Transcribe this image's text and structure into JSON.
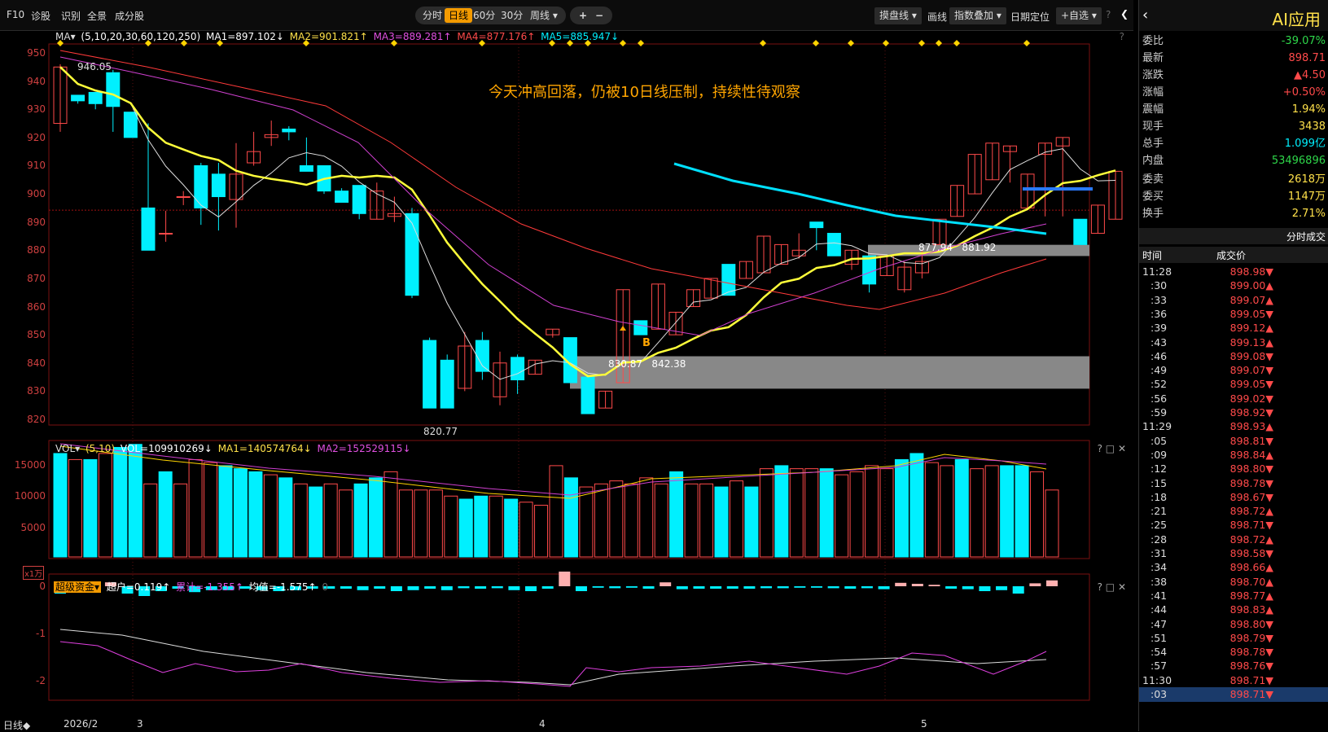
{
  "toolbar": {
    "left": [
      "F10",
      "诊股",
      "识别",
      "全景",
      "成分股"
    ],
    "periods": [
      "分时",
      "日线",
      "60分",
      "30分",
      "周线 ▾"
    ],
    "active_period": "日线",
    "zoom": [
      "+",
      "−"
    ],
    "right": [
      "摸盘线 ▾",
      "画线",
      "指数叠加 ▾",
      "日期定位",
      "+自选 ▾"
    ],
    "help": "?",
    "collapse": "❮"
  },
  "main": {
    "indicator": "MA▾",
    "params": "(5,10,20,30,60,120,250)",
    "ma1": "MA1=897.102↓",
    "ma2": "MA2=901.821↑",
    "ma3": "MA3=889.281↑",
    "ma4": "MA4=877.176↑",
    "ma5": "MA5=885.947↓",
    "help": "?",
    "annotation": "今天冲高回落，仍被10日线压制，持续性待观察",
    "hi_label": "946.05",
    "lo_label": "820.77",
    "zone1_label": "830.87   842.38",
    "zone2_label": "877.94   881.92",
    "b_marker": "B",
    "yticks": [
      "950",
      "940",
      "930",
      "920",
      "910",
      "900",
      "890",
      "880",
      "870",
      "860",
      "850",
      "840",
      "830",
      "820"
    ]
  },
  "vol": {
    "indicator": "VOL▾",
    "params": "(5,10)",
    "vol": "VOL=109910269↓",
    "ma1": "MA1=140574764↓",
    "ma2": "MA2=152529115↓",
    "yticks": [
      "15000",
      "10000",
      "5000"
    ],
    "unit": "x1万",
    "ctrls": "? □ ✕"
  },
  "fund": {
    "indicator": "超级资金▾",
    "chaohu": "超户=0.119↑",
    "leiji": "累计=-1.355↑",
    "junzhi": "均值=-1.575↑",
    "trail": "0",
    "yticks": [
      "0",
      "-1",
      "-2"
    ],
    "ctrls": "? □ ✕"
  },
  "xaxis": {
    "mode": "日线◆",
    "labels": [
      "2026/2",
      "3",
      "4",
      "5"
    ]
  },
  "chart_data": {
    "type": "candlestick",
    "ylim": [
      817,
      952
    ],
    "dates_section": [
      "2026/2",
      "3",
      "4",
      "5"
    ],
    "candles": [
      [
        946,
        922,
        925,
        945
      ],
      [
        934,
        932,
        935,
        933
      ],
      [
        935,
        930,
        936,
        932
      ],
      [
        944,
        922,
        943,
        931
      ],
      [
        928,
        925,
        929,
        920
      ],
      [
        925,
        889,
        895,
        880
      ],
      [
        894,
        883,
        886,
        886
      ],
      [
        901,
        896,
        899,
        899
      ],
      [
        911,
        889,
        910,
        895
      ],
      [
        911,
        887,
        907,
        899
      ],
      [
        918,
        888,
        898,
        907
      ],
      [
        922,
        910,
        911,
        915
      ],
      [
        926,
        917,
        920,
        921
      ],
      [
        924,
        919,
        923,
        922
      ],
      [
        920,
        913,
        910,
        908
      ],
      [
        910,
        900,
        910,
        901
      ],
      [
        902,
        898,
        901,
        897
      ],
      [
        903,
        891,
        903,
        893
      ],
      [
        904,
        892,
        891,
        901
      ],
      [
        899,
        890,
        892,
        893
      ],
      [
        895,
        863,
        893,
        864
      ],
      [
        849,
        825,
        848,
        824
      ],
      [
        843,
        829,
        841,
        824
      ],
      [
        851,
        830,
        831,
        846
      ],
      [
        851,
        834,
        848,
        837
      ],
      [
        844,
        825,
        828,
        840
      ],
      [
        843,
        829,
        842,
        834
      ],
      [
        841,
        836,
        836,
        841
      ],
      [
        850,
        849,
        850,
        852
      ],
      [
        848,
        833,
        849,
        833
      ],
      [
        836,
        824,
        835,
        822
      ],
      [
        827,
        826,
        824,
        830
      ],
      [
        865,
        838,
        833,
        866
      ],
      [
        855,
        851,
        855,
        850
      ],
      [
        859,
        852,
        852,
        868
      ],
      [
        856,
        851,
        850,
        858
      ],
      [
        865,
        862,
        860,
        866
      ],
      [
        870,
        863,
        863,
        870
      ],
      [
        875,
        866,
        875,
        864
      ],
      [
        874,
        871,
        870,
        876
      ],
      [
        880,
        873,
        872,
        885
      ],
      [
        880,
        875,
        875,
        882
      ],
      [
        886,
        877,
        878,
        880
      ],
      [
        890,
        880,
        890,
        888
      ],
      [
        886,
        881,
        886,
        878
      ],
      [
        876,
        873,
        875,
        880
      ],
      [
        878,
        865,
        878,
        868
      ],
      [
        876,
        871,
        871,
        878
      ],
      [
        876,
        865,
        866,
        874
      ],
      [
        880,
        870,
        872,
        876
      ],
      [
        889,
        882,
        882,
        891
      ],
      [
        903,
        892,
        892,
        903
      ],
      [
        911,
        901,
        900,
        914
      ],
      [
        916,
        913,
        905,
        918
      ],
      [
        916,
        904,
        915,
        917
      ],
      [
        906,
        904,
        895,
        907
      ],
      [
        914,
        892,
        914,
        918
      ],
      [
        918,
        892,
        917,
        920
      ],
      [
        891,
        886,
        891,
        882
      ],
      [
        894,
        887,
        886,
        896
      ],
      [
        899,
        891,
        891,
        908
      ]
    ],
    "high_label": 946.05,
    "low_label": 820.77,
    "volume": [
      17000,
      16000,
      16000,
      17000,
      18000,
      18500,
      12000,
      14000,
      12000,
      16000,
      15500,
      15000,
      14500,
      14000,
      13500,
      13000,
      12000,
      11500,
      12000,
      11000,
      12000,
      13000,
      14000,
      11000,
      11000,
      11000,
      10000,
      9500,
      10000,
      10000,
      9500,
      9000,
      8500,
      15000,
      13000,
      11500,
      12000,
      12500,
      12000,
      13000,
      12000,
      14000,
      12000,
      12000,
      11500,
      12500,
      11500,
      14500,
      15000,
      14500,
      14500,
      14500,
      13500,
      14000,
      15000,
      14500,
      16000,
      17000,
      15500,
      15000,
      16000,
      14500,
      15000,
      15000,
      15000,
      14000,
      11000
    ],
    "volume_colors_up": [
      false,
      true,
      false,
      true,
      false,
      false,
      true,
      false,
      true,
      true,
      true,
      false,
      false,
      false,
      true,
      false,
      true,
      false,
      true,
      true,
      false,
      false,
      true,
      true,
      true,
      true,
      true,
      false,
      false,
      true,
      false,
      true,
      true,
      true,
      false,
      true,
      true,
      true,
      true,
      true,
      true,
      false,
      true,
      true,
      false,
      true,
      false,
      true,
      false,
      true,
      true,
      false,
      true,
      true,
      true,
      true,
      false,
      false,
      true,
      true,
      false,
      true,
      true,
      false,
      false,
      true,
      true
    ],
    "fund_bars": [
      -0.15,
      -0.1,
      -0.08,
      0.08,
      -0.15,
      -0.2,
      -0.1,
      -0.05,
      -0.12,
      -0.08,
      -0.08,
      -0.05,
      -0.08,
      -0.1,
      -0.08,
      -0.05,
      -0.05,
      -0.05,
      -0.08,
      -0.05,
      -0.1,
      -0.08,
      -0.05,
      -0.08,
      -0.04,
      -0.05,
      -0.04,
      -0.08,
      -0.1,
      -0.05,
      0.3,
      -0.1,
      -0.03,
      -0.04,
      -0.03,
      -0.05,
      0.08,
      -0.06,
      -0.05,
      -0.05,
      -0.05,
      -0.05,
      -0.04,
      -0.04,
      -0.03,
      -0.03,
      -0.04,
      -0.05,
      -0.04,
      -0.06,
      0.07,
      0.05,
      0.03,
      -0.05,
      -0.06,
      -0.1,
      -0.08,
      -0.15,
      0.06,
      0.12
    ]
  },
  "side": {
    "title": "AI应用",
    "rows": [
      [
        "委比",
        "-39.07%",
        "grn"
      ],
      [
        "最新",
        "898.71",
        "red"
      ],
      [
        "涨跌",
        "▲4.50",
        "red"
      ],
      [
        "涨幅",
        "+0.50%",
        "red"
      ],
      [
        "震幅",
        "1.94%",
        "yl"
      ],
      [
        "现手",
        "3438",
        "yl"
      ],
      [
        "总手",
        "1.099亿",
        "cy"
      ],
      [
        "内盘",
        "53496896",
        "grn"
      ],
      [
        "委卖",
        "2618万",
        "yl"
      ],
      [
        "委买",
        "1147万",
        "yl"
      ],
      [
        "换手",
        "2.71%",
        "yl"
      ]
    ],
    "section": "分时成交",
    "col_time": "时间",
    "col_price": "成交价",
    "trades": [
      [
        "11:28",
        "898.98▼",
        "red"
      ],
      [
        ":30",
        "899.00▲",
        "red"
      ],
      [
        ":33",
        "899.07▲",
        "red"
      ],
      [
        ":36",
        "899.05▼",
        "red"
      ],
      [
        ":39",
        "899.12▲",
        "red"
      ],
      [
        ":43",
        "899.13▲",
        "red"
      ],
      [
        ":46",
        "899.08▼",
        "red"
      ],
      [
        ":49",
        "899.07▼",
        "red"
      ],
      [
        ":52",
        "899.05▼",
        "red"
      ],
      [
        ":56",
        "899.02▼",
        "red"
      ],
      [
        ":59",
        "898.92▼",
        "red"
      ],
      [
        "11:29",
        "898.93▲",
        "red"
      ],
      [
        ":05",
        "898.81▼",
        "red"
      ],
      [
        ":09",
        "898.84▲",
        "red"
      ],
      [
        ":12",
        "898.80▼",
        "red"
      ],
      [
        ":15",
        "898.78▼",
        "red"
      ],
      [
        ":18",
        "898.67▼",
        "red"
      ],
      [
        ":21",
        "898.72▲",
        "red"
      ],
      [
        ":25",
        "898.71▼",
        "red"
      ],
      [
        ":28",
        "898.72▲",
        "red"
      ],
      [
        ":31",
        "898.58▼",
        "red"
      ],
      [
        ":34",
        "898.66▲",
        "red"
      ],
      [
        ":38",
        "898.70▲",
        "red"
      ],
      [
        ":41",
        "898.77▲",
        "red"
      ],
      [
        ":44",
        "898.83▲",
        "red"
      ],
      [
        ":47",
        "898.80▼",
        "red"
      ],
      [
        ":51",
        "898.79▼",
        "red"
      ],
      [
        ":54",
        "898.78▼",
        "red"
      ],
      [
        ":57",
        "898.76▼",
        "red"
      ],
      [
        "11:30",
        "898.71▼",
        "red"
      ],
      [
        ":03",
        "898.71▼",
        "red"
      ]
    ]
  }
}
